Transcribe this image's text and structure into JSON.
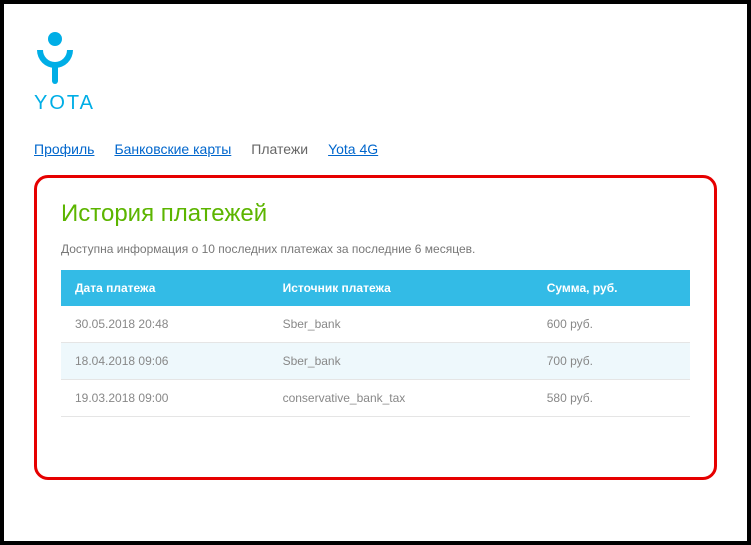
{
  "brand": "YOTA",
  "nav": {
    "profile": "Профиль",
    "cards": "Банковские карты",
    "payments": "Платежи",
    "yota4g": "Yota 4G"
  },
  "panel": {
    "title": "История платежей",
    "subtitle": "Доступна информация о 10 последних платежах за последние 6 месяцев."
  },
  "table": {
    "headers": {
      "date": "Дата платежа",
      "source": "Источник платежа",
      "sum": "Сумма, руб."
    },
    "rows": [
      {
        "date": "30.05.2018 20:48",
        "source": "Sber_bank",
        "sum": "600 руб."
      },
      {
        "date": "18.04.2018 09:06",
        "source": "Sber_bank",
        "sum": "700 руб."
      },
      {
        "date": "19.03.2018 09:00",
        "source": "conservative_bank_tax",
        "sum": "580 руб."
      }
    ]
  }
}
